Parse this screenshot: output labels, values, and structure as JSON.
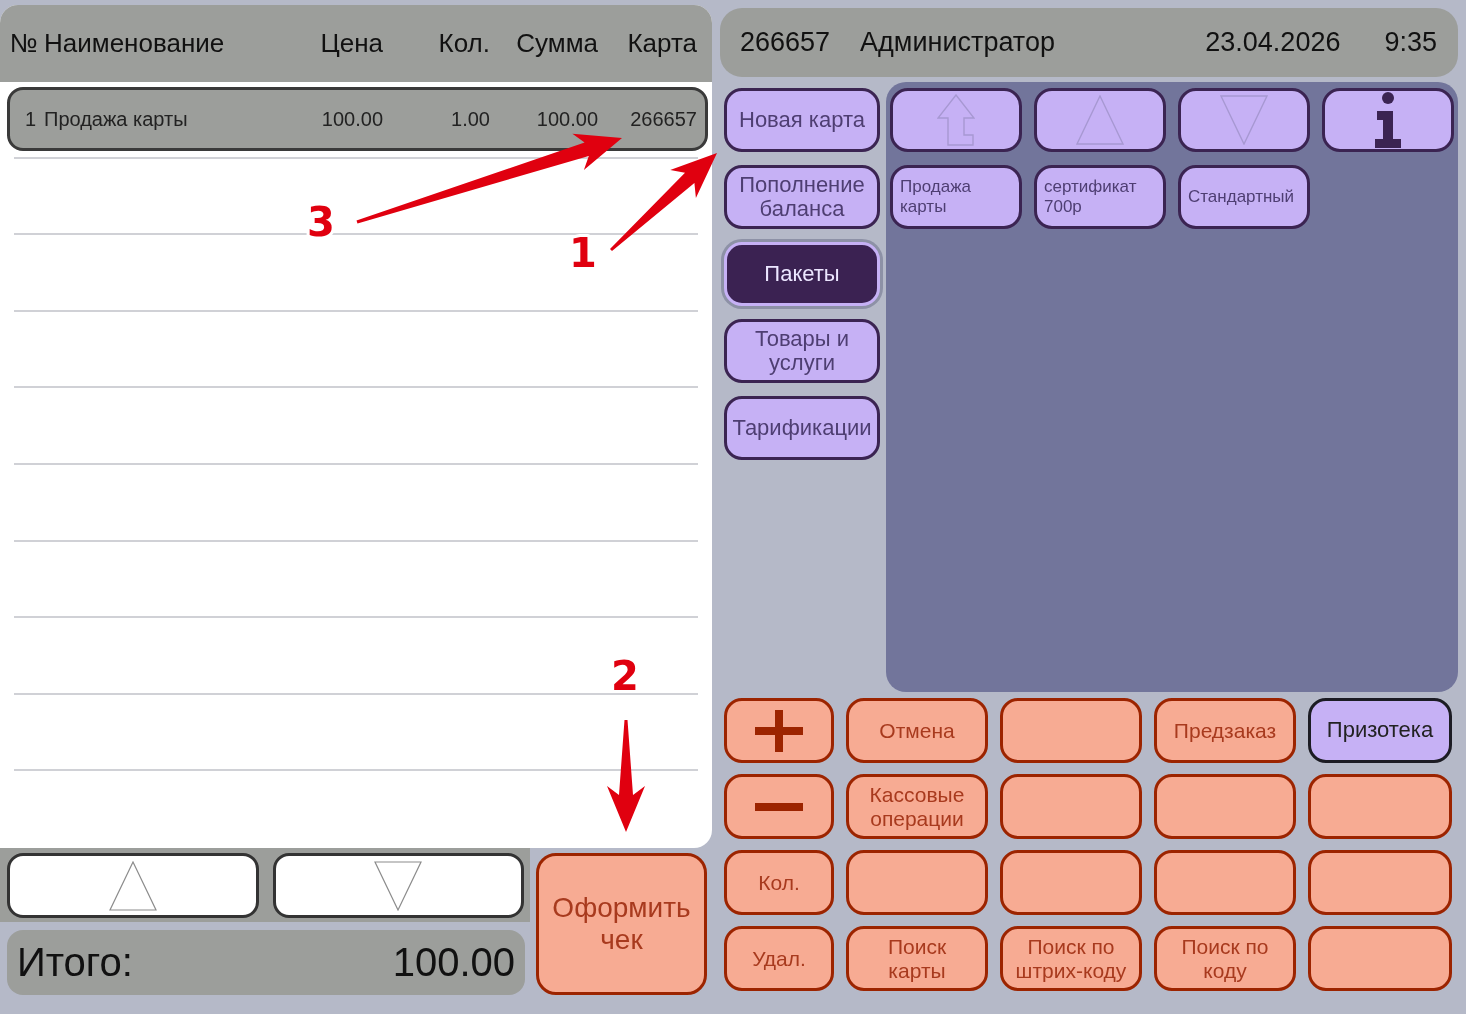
{
  "order_table": {
    "columns": [
      "№",
      "Наименование",
      "Цена",
      "Кол.",
      "Сумма",
      "Карта"
    ],
    "rows": [
      {
        "cells": [
          "1",
          "Продажа карты",
          "100.00",
          "1.00",
          "100.00",
          "266657"
        ],
        "selected": true
      }
    ]
  },
  "total": {
    "label": "Итого:",
    "value": "100.00"
  },
  "checkout_button": "Оформить чек",
  "status_bar": {
    "card": "266657",
    "user": "Администратор",
    "date": "23.04.2026",
    "time": "9:35"
  },
  "categories": [
    {
      "label": "Новая карта",
      "selected": false
    },
    {
      "label": "Пополнение баланса",
      "selected": false
    },
    {
      "label": "Пакеты",
      "selected": true
    },
    {
      "label": "Товары и услуги",
      "selected": false
    },
    {
      "label": "Тарификации",
      "selected": false
    }
  ],
  "products": {
    "nav_buttons": [
      {
        "kind": "level-up",
        "disabled": true
      },
      {
        "kind": "up",
        "disabled": true
      },
      {
        "kind": "down",
        "disabled": true
      },
      {
        "kind": "info",
        "disabled": false
      }
    ],
    "items": [
      "Продажа карты",
      "сертификат 700р",
      "Стандартный"
    ]
  },
  "function_keys": [
    {
      "kind": "plus",
      "active": false
    },
    {
      "kind": "text",
      "label": "Отмена",
      "active": false
    },
    {
      "kind": "blank",
      "active": false
    },
    {
      "kind": "text",
      "label": "Предзаказ",
      "active": false
    },
    {
      "kind": "text",
      "label": "Призотека",
      "active": true
    },
    {
      "kind": "minus",
      "active": false
    },
    {
      "kind": "text",
      "label": "Кассовые операции",
      "active": false
    },
    {
      "kind": "blank",
      "active": false
    },
    {
      "kind": "blank",
      "active": false
    },
    {
      "kind": "blank",
      "active": false
    },
    {
      "kind": "text",
      "label": "Кол.",
      "active": false
    },
    {
      "kind": "blank",
      "active": false
    },
    {
      "kind": "blank",
      "active": false
    },
    {
      "kind": "blank",
      "active": false
    },
    {
      "kind": "blank",
      "active": false
    },
    {
      "kind": "text",
      "label": "Удал.",
      "active": false
    },
    {
      "kind": "text",
      "label": "Поиск карты",
      "active": false
    },
    {
      "kind": "text",
      "label": "Поиск по штрих-коду",
      "active": false
    },
    {
      "kind": "text",
      "label": "Поиск по коду",
      "active": false
    },
    {
      "kind": "blank",
      "active": false
    }
  ],
  "annotations": [
    {
      "number": "3"
    },
    {
      "number": "1"
    },
    {
      "number": "2"
    }
  ]
}
